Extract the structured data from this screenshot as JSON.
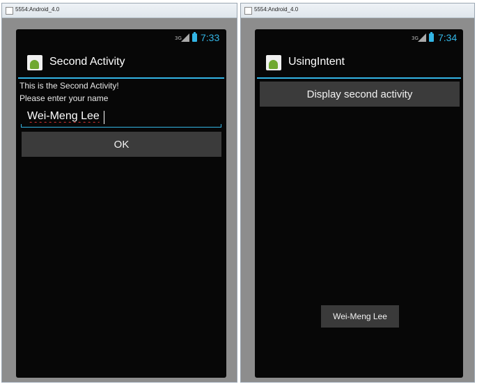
{
  "left_window": {
    "title": "5554:Android_4.0",
    "status": {
      "network": "3G",
      "time": "7:33"
    },
    "action_bar_title": "Second Activity",
    "line1": "This is the Second Activity!",
    "line2": "Please enter your name",
    "name_input_value": "Wei-Meng Lee",
    "ok_label": "OK"
  },
  "right_window": {
    "title": "5554:Android_4.0",
    "status": {
      "network": "3G",
      "time": "7:34"
    },
    "action_bar_title": "UsingIntent",
    "display_button_label": "Display second activity",
    "toast_text": "Wei-Meng Lee"
  },
  "colors": {
    "accent": "#33b5e5",
    "screen_bg": "#070707",
    "button_bg": "#3b3b3b"
  },
  "icons": [
    "battery-icon",
    "signal-icon",
    "android-app-icon"
  ]
}
